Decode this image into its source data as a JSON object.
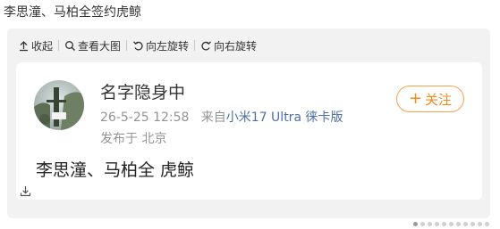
{
  "post": {
    "text": "李思潼、马柏全签约虎鲸"
  },
  "toolbar": {
    "items": [
      {
        "label": "收起",
        "icon": "collapse-icon"
      },
      {
        "label": "查看大图",
        "icon": "magnifier-icon"
      },
      {
        "label": "向左旋转",
        "icon": "rotate-left-icon"
      },
      {
        "label": "向右旋转",
        "icon": "rotate-right-icon"
      }
    ]
  },
  "card": {
    "username": "名字隐身中",
    "timestamp": "26-5-25 12:58",
    "source_prefix": "来自",
    "source": "小米17 Ultra 徕卡版",
    "location_prefix": "发布于",
    "location": "北京",
    "follow_label": "关注",
    "body": "李思潼、马柏全 虎鲸"
  },
  "colors": {
    "accent": "#f28a1c",
    "link": "#4d6fa3",
    "muted": "#939393",
    "panel": "#f2f2f2"
  }
}
